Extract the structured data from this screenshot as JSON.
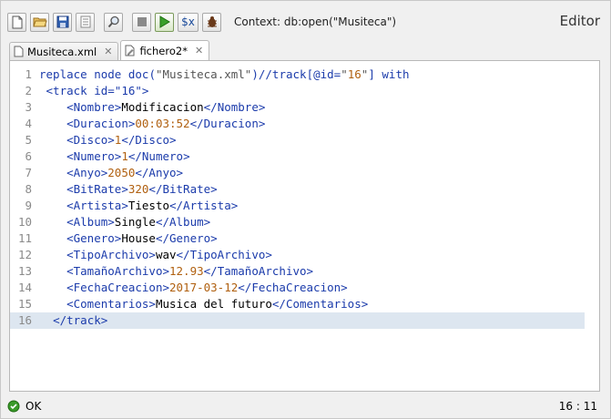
{
  "toolbar": {
    "buttons": [
      {
        "name": "new-file-icon"
      },
      {
        "name": "open-folder-icon"
      },
      {
        "name": "save-icon"
      },
      {
        "name": "format-icon"
      },
      {
        "name": "search-icon"
      },
      {
        "name": "stop-icon"
      },
      {
        "name": "run-icon"
      },
      {
        "name": "variables-button",
        "label": "$x"
      },
      {
        "name": "debug-icon"
      }
    ],
    "context_label": "Context: db:open(\"Musiteca\")"
  },
  "editor_title": "Editor",
  "tabs": [
    {
      "label": "Musiteca.xml",
      "active": false
    },
    {
      "label": "fichero2*",
      "active": true
    }
  ],
  "code_lines": [
    "replace node doc(\"Musiteca.xml\")//track[@id=\"16\"] with",
    " <track id=\"16\">",
    "    <Nombre>Modificacion</Nombre>",
    "    <Duracion>00:03:52</Duracion>",
    "    <Disco>1</Disco>",
    "    <Numero>1</Numero>",
    "    <Anyo>2050</Anyo>",
    "    <BitRate>320</BitRate>",
    "    <Artista>Tiesto</Artista>",
    "    <Album>Single</Album>",
    "    <Genero>House</Genero>",
    "    <TipoArchivo>wav</TipoArchivo>",
    "    <TamañoArchivo>12.93</TamañoArchivo>",
    "    <FechaCreacion>2017-03-12</FechaCreacion>",
    "    <Comentarios>Musica del futuro</Comentarios>",
    "  </track>"
  ],
  "current_line": 16,
  "status": {
    "text": "OK",
    "cursor": "16 : 11"
  },
  "colors": {
    "tag": "#1b3bab",
    "number": "#b06010",
    "current_line_bg": "#dde6f0",
    "ok_icon": "#3a9a2a"
  }
}
